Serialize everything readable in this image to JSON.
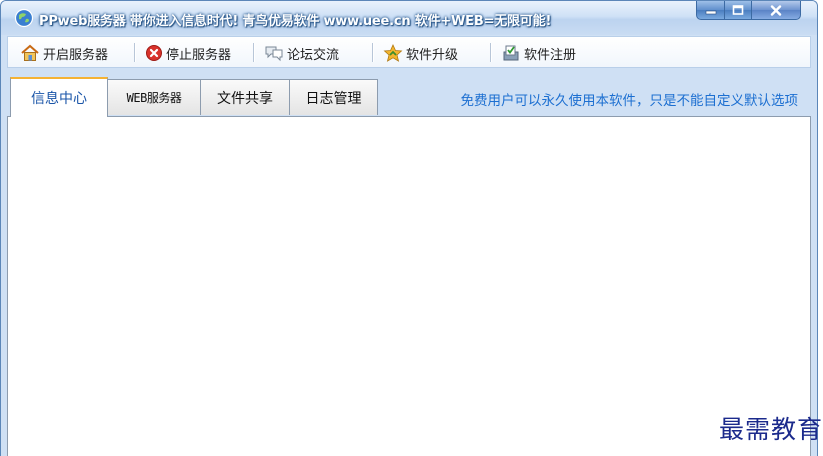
{
  "window": {
    "title": "PPweb服务器 带你进入信息时代! 青鸟优易软件 www.uee.cn 软件+WEB=无限可能!",
    "icon": "app-globe-icon",
    "controls": {
      "minimize_icon": "minimize-icon",
      "maximize_icon": "maximize-icon",
      "close_icon": "close-icon"
    }
  },
  "toolbar": {
    "items": [
      {
        "label": "开启服务器",
        "icon": "home-icon"
      },
      {
        "label": "停止服务器",
        "icon": "stop-icon"
      },
      {
        "label": "论坛交流",
        "icon": "chat-icon"
      },
      {
        "label": "软件升级",
        "icon": "upgrade-star-icon"
      },
      {
        "label": "软件注册",
        "icon": "register-icon"
      }
    ]
  },
  "tabs": [
    {
      "label": "信息中心",
      "active": true
    },
    {
      "label": "WEB服务器",
      "active": false
    },
    {
      "label": "文件共享",
      "active": false
    },
    {
      "label": "日志管理",
      "active": false
    }
  ],
  "notice": "免费用户可以永久使用本软件，只是不能自定义默认选项",
  "watermark": "最需教育",
  "colors": {
    "title_text": "#ffffff",
    "active_tab_text": "#1a55a8",
    "active_tab_accent": "#f5b233",
    "notice_text": "#1c6fd1",
    "watermark_text": "#1b2a8c",
    "frame": "#cfe0f4"
  }
}
